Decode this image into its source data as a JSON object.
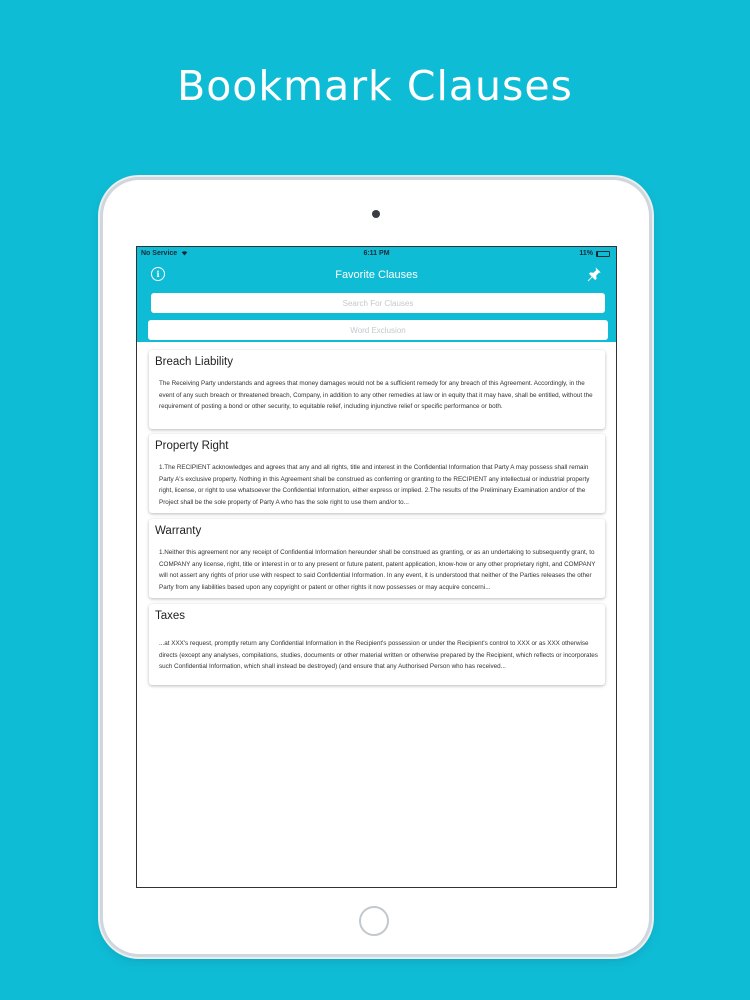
{
  "headline": "Bookmark Clauses",
  "status_bar": {
    "carrier": "No Service",
    "time": "6:11 PM",
    "battery_text": "11%",
    "battery_level": 0.11
  },
  "nav": {
    "title": "Favorite Clauses",
    "left_icon": "info-icon",
    "right_icon": "pin-icon"
  },
  "search": {
    "placeholder": "Search For Clauses",
    "exclusion_placeholder": "Word Exclusion"
  },
  "colors": {
    "accent": "#0fbcd6",
    "background": "#0fbcd6"
  },
  "clauses": [
    {
      "title": "Breach Liability",
      "text": "The Receiving Party understands and agrees that money damages would not be a sufficient remedy for any breach of this Agreement. Accordingly, in the event of any such breach or threatened breach, Company, in addition to any other remedies at law or in equity that it may have, shall be entitled, without the requirement of posting a bond or other security, to equitable relief, including injunctive relief or specific performance or both."
    },
    {
      "title": "Property Right",
      "text": "1.The RECIPIENT acknowledges and agrees that any and all rights, title and interest in the Confidential Information that Party A may possess shall remain Party A's exclusive property. Nothing in this Agreement shall be construed as conferring or granting to the RECIPIENT any intellectual or industrial property right, license, or right to use whatsoever the Confidential Information, either express or implied. 2.The results of the Preliminary Examination and/or of the Project shall be the sole property of Party A who has the sole right to use them and/or to..."
    },
    {
      "title": "Warranty",
      "text": "1.Neither this agreement nor any receipt of Confidential Information hereunder shall be construed as granting, or as an undertaking to subsequently grant, to COMPANY any license, right, title or interest in or to any present or future patent, patent application, know-how or any other proprietary right, and COMPANY will not assert any rights of prior use with respect to said Confidential Information. In any event, it is understood that neither of the Parties releases the other Party from any liabilities based upon any copyright or patent or other rights it now possesses or may acquire concerni..."
    },
    {
      "title": "Taxes",
      "text": "...at XXX's request, promptly return any Confidential Information in the Recipient's possession or under the Recipient's control to XXX or as XXX otherwise directs (except any analyses, compilations, studies, documents or other material written or otherwise prepared by the Recipient, which reflects or incorporates such Confidential Information, which shall instead be destroyed) (and ensure that any Authorised Person who has received..."
    }
  ]
}
